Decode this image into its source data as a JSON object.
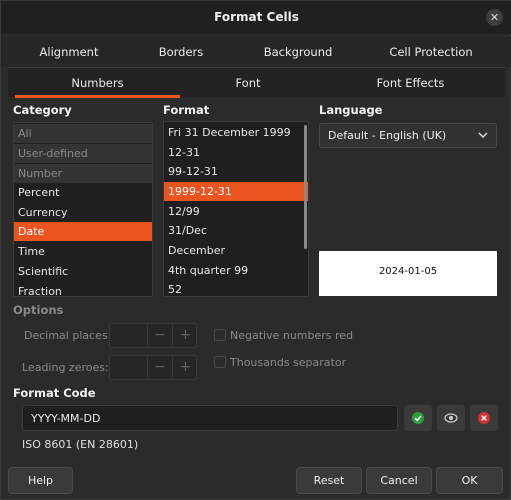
{
  "dialog": {
    "title": "Format Cells"
  },
  "tabs_top": [
    "Alignment",
    "Borders",
    "Background",
    "Cell Protection"
  ],
  "tabs_sub": [
    "Numbers",
    "Font",
    "Font Effects"
  ],
  "category": {
    "heading": "Category",
    "items": [
      "All",
      "User-defined",
      "Number",
      "Percent",
      "Currency",
      "Date",
      "Time",
      "Scientific",
      "Fraction"
    ],
    "selected": "Date"
  },
  "format": {
    "heading": "Format",
    "items": [
      "Fri 31 December 1999",
      "12-31",
      "99-12-31",
      "1999-12-31",
      "12/99",
      "31/Dec",
      "December",
      "4th quarter 99",
      "52"
    ],
    "selected": "1999-12-31"
  },
  "language": {
    "heading": "Language",
    "value": "Default - English (UK)"
  },
  "preview": {
    "text": "2024-01-05"
  },
  "options": {
    "heading": "Options",
    "decimal_label": "Decimal places:",
    "leading_label": "Leading zeroes:",
    "neg_label": "Negative numbers red",
    "thousands_label": "Thousands separator"
  },
  "format_code": {
    "heading": "Format Code",
    "value": "YYYY-MM-DD",
    "description": "ISO 8601 (EN 28601)"
  },
  "buttons": {
    "help": "Help",
    "reset": "Reset",
    "cancel": "Cancel",
    "ok": "OK"
  },
  "icons": {
    "close": "close-icon",
    "dropdown": "chevron-down-icon",
    "accept": "check-icon",
    "comment": "eye-icon",
    "delete": "delete-icon"
  },
  "colors": {
    "accent": "#e95420",
    "accept": "#2e9e3e",
    "delete": "#d33131"
  }
}
